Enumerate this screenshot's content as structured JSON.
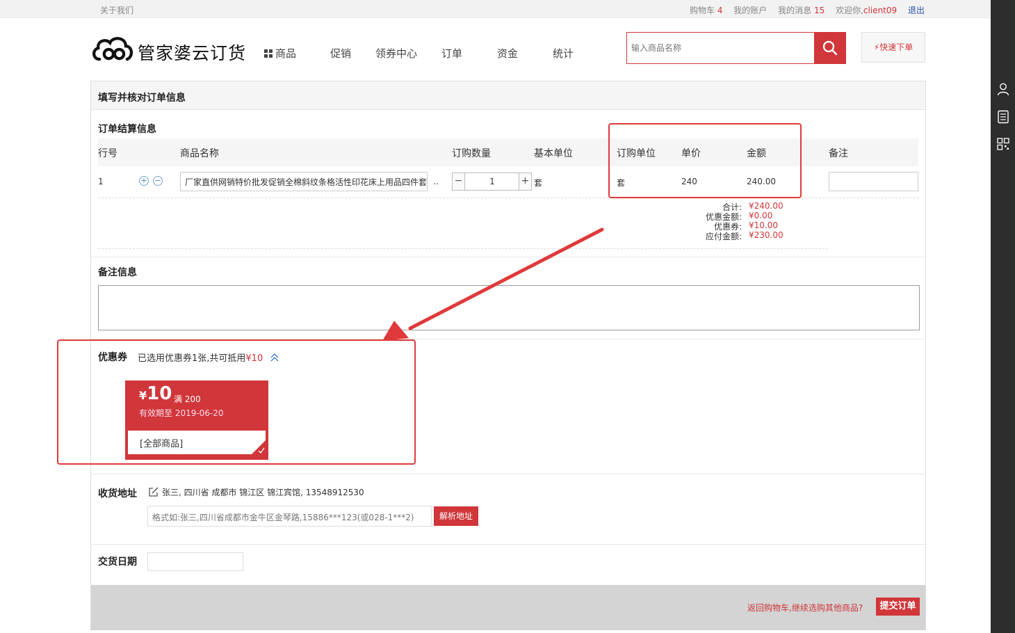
{
  "topbar": {
    "about": "关于我们",
    "cart_label": "购物车",
    "cart_count": "4",
    "account": "我的账户",
    "messages_label": "我的消息",
    "messages_count": "15",
    "welcome": "欢迎你,",
    "username": "client09",
    "logout": "退出"
  },
  "header": {
    "logo_text": "管家婆云订货",
    "nav": [
      "商品",
      "促销",
      "领券中心",
      "订单",
      "资金",
      "统计"
    ],
    "search_placeholder": "输入商品名称",
    "quick_order": "快速下单"
  },
  "page": {
    "title": "填写并核对订单信息",
    "settlement_title": "订单结算信息",
    "columns": [
      "行号",
      "商品名称",
      "订购数量",
      "基本单位",
      "订购单位",
      "单价",
      "金额",
      "备注"
    ],
    "row": {
      "no": "1",
      "name": "厂家直供网销特价批发促销全棉斜纹条格活性印花床上用品四件套",
      "ellipsis": "..",
      "qty": "1",
      "qty_minus": "−",
      "qty_plus": "+",
      "base_unit": "套",
      "order_unit": "套",
      "price": "240",
      "amount": "240.00"
    },
    "totals": [
      {
        "label": "合计:",
        "value": "¥240.00"
      },
      {
        "label": "优惠金额:",
        "value": "¥0.00"
      },
      {
        "label": "优惠券:",
        "value": "¥10.00"
      },
      {
        "label": "应付金额:",
        "value": "¥230.00"
      }
    ],
    "remark_title": "备注信息",
    "coupon": {
      "title": "优惠券",
      "summary": "已选用优惠券1张,共可抵用",
      "summary_amount": "¥10",
      "card_currency": "¥",
      "card_amount": "10",
      "card_threshold": "满 200",
      "card_expiry": "有效期至 2019-06-20",
      "card_scope": "[全部商品]"
    },
    "address": {
      "title": "收货地址",
      "value": "张三, 四川省 成都市 锦江区 锦江宾馆, 13548912530",
      "placeholder": "格式如:张三,四川省成都市金牛区金琴路,15886***123(或028-1***2)",
      "parse_button": "解析地址"
    },
    "delivery_title": "交货日期",
    "footer": {
      "back_link": "返回购物车,继续选购其他商品?",
      "submit": "提交订单"
    }
  },
  "colors": {
    "accent": "#d0363a",
    "annotation": "#e0393a"
  }
}
